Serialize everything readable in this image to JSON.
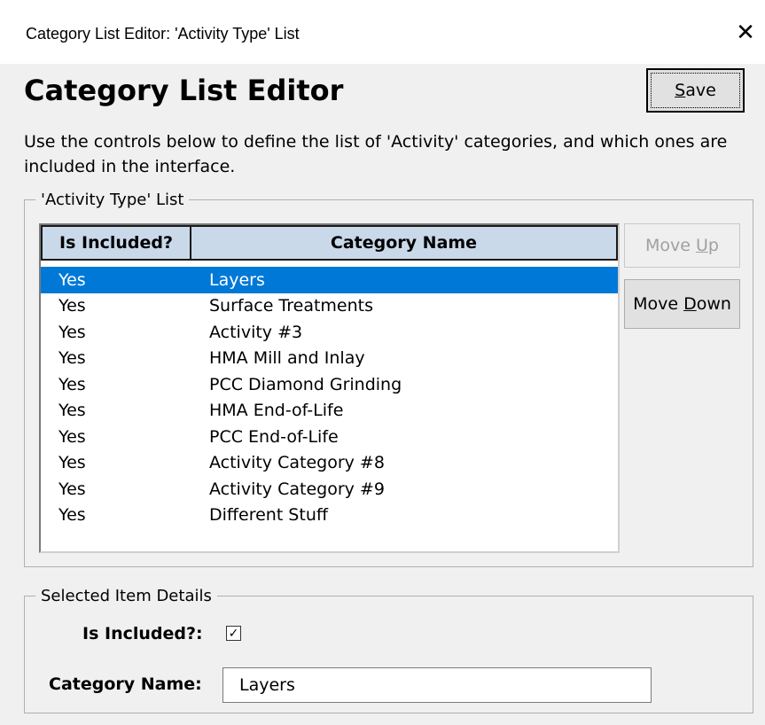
{
  "window": {
    "title": "Category List Editor: 'Activity Type' List",
    "close_glyph": "✕"
  },
  "header": {
    "heading": "Category List Editor",
    "save_pre": "",
    "save_ul": "S",
    "save_post": "ave"
  },
  "description": "Use the controls below to define the list of 'Activity' categories, and which ones are included in the interface.",
  "list_group": {
    "legend": "'Activity Type' List",
    "columns": [
      "Is Included?",
      "Category Name"
    ],
    "rows": [
      [
        "Yes",
        "Layers"
      ],
      [
        "Yes",
        "Surface Treatments"
      ],
      [
        "Yes",
        "Activity #3"
      ],
      [
        "Yes",
        "HMA Mill and Inlay"
      ],
      [
        "Yes",
        "PCC Diamond Grinding"
      ],
      [
        "Yes",
        "HMA End-of-Life"
      ],
      [
        "Yes",
        "PCC End-of-Life"
      ],
      [
        "Yes",
        "Activity Category #8"
      ],
      [
        "Yes",
        "Activity Category #9"
      ],
      [
        "Yes",
        "Different Stuff"
      ]
    ],
    "selected_index": 0,
    "move_up": {
      "pre": "Move ",
      "ul": "U",
      "post": "p"
    },
    "move_down": {
      "pre": "Move ",
      "ul": "D",
      "post": "own"
    }
  },
  "details": {
    "legend": "Selected Item Details",
    "is_included_label": "Is Included?:",
    "is_included_checked": true,
    "check_glyph": "✓",
    "category_name_label": "Category Name:",
    "category_name_value": "Layers"
  },
  "colors": {
    "selection": "#0078d7",
    "header_bg": "#c9d9ea",
    "window_bg": "#f0f0f0"
  }
}
